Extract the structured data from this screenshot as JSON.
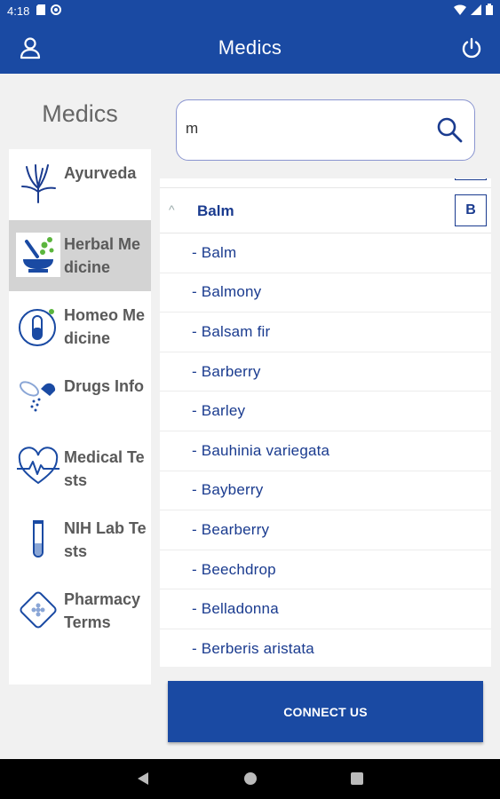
{
  "status_bar": {
    "time": "4:18",
    "left_icons": [
      "sd-card-icon",
      "settings-circle-icon"
    ],
    "right_icons": [
      "wifi-icon",
      "signal-icon",
      "battery-icon"
    ]
  },
  "app_bar": {
    "title": "Medics",
    "left_icon": "user-icon",
    "right_icon": "power-icon"
  },
  "sidebar": {
    "title": "Medics",
    "items": [
      {
        "label": "Ayurveda",
        "icon": "ayurveda-icon",
        "active": false
      },
      {
        "label": "Herbal Medicine",
        "icon": "mortar-pestle-icon",
        "active": true
      },
      {
        "label": "Homeo Medicine",
        "icon": "capsule-icon",
        "active": false
      },
      {
        "label": "Drugs Info",
        "icon": "pills-icon",
        "active": false
      },
      {
        "label": "Medical Tests",
        "icon": "heartbeat-icon",
        "active": false
      },
      {
        "label": "NIH Lab Tests",
        "icon": "test-tube-icon",
        "active": false
      },
      {
        "label": "Pharmacy Terms",
        "icon": "tablet-pack-icon",
        "active": false
      }
    ]
  },
  "search": {
    "value": "m",
    "icon": "search-icon"
  },
  "list": {
    "group": {
      "name": "Balm",
      "letter": "B",
      "expanded": true
    },
    "items": [
      "- Balm",
      "- Balmony",
      "- Balsam fir",
      "- Barberry",
      "- Barley",
      "- Bauhinia variegata",
      "- Bayberry",
      "- Bearberry",
      "- Beechdrop",
      "- Belladonna",
      "- Berberis aristata"
    ]
  },
  "connect_button": {
    "label": "CONNECT US"
  },
  "nav_bar": {
    "buttons": [
      "back-icon",
      "home-icon",
      "recents-icon"
    ]
  },
  "colors": {
    "primary": "#1a4aa3",
    "list_text": "#1a3b8f",
    "active_item_bg": "#d3d3d3"
  }
}
